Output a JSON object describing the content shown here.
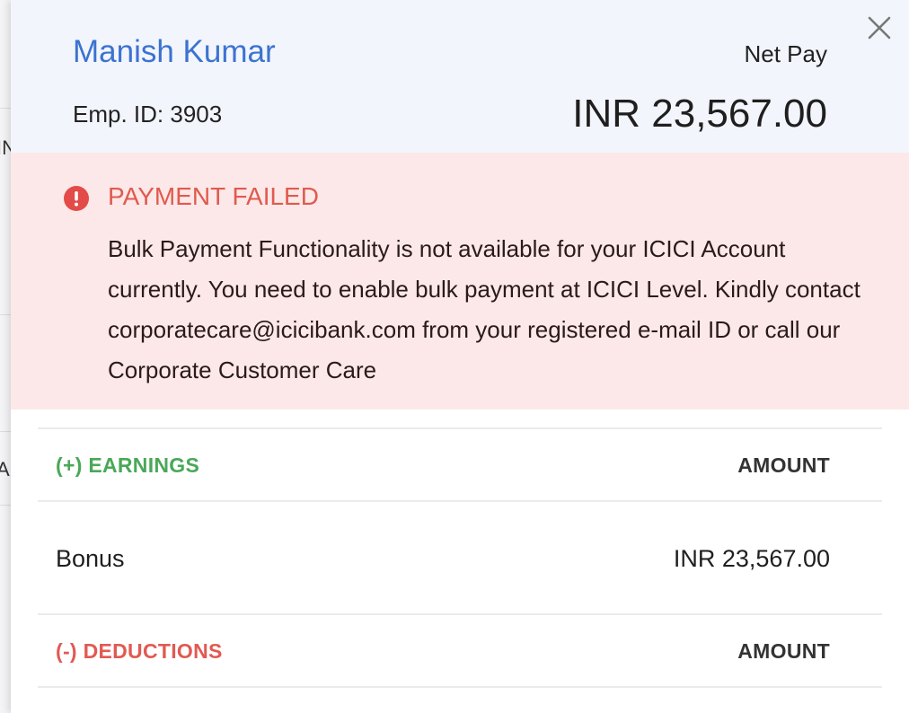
{
  "background_fragments": [
    "IN",
    "A"
  ],
  "header": {
    "employee_name": "Manish Kumar",
    "employee_id": "Emp. ID: 3903",
    "net_pay_label": "Net Pay",
    "net_pay_amount": "INR 23,567.00",
    "close_icon": "close-icon"
  },
  "alert": {
    "icon": "exclamation-circle-icon",
    "title": "PAYMENT FAILED",
    "message": "Bulk Payment Functionality is not available for your ICICI Account currently. You need to enable bulk payment at ICICI Level. Kindly contact corporatecare@icicibank.com from your registered e-mail ID or call our Corporate Customer Care"
  },
  "earnings": {
    "section_label": "(+) EARNINGS",
    "amount_header": "AMOUNT",
    "items": [
      {
        "label": "Bonus",
        "amount": "INR 23,567.00"
      }
    ]
  },
  "deductions": {
    "section_label": "(-) DEDUCTIONS",
    "amount_header": "AMOUNT"
  },
  "colors": {
    "name_blue": "#3b73d0",
    "alert_red": "#e05a4e",
    "alert_bg": "#fce8e8",
    "earnings_green": "#4aa858",
    "deductions_red": "#e15a52",
    "header_bg": "#f3f5fc"
  }
}
